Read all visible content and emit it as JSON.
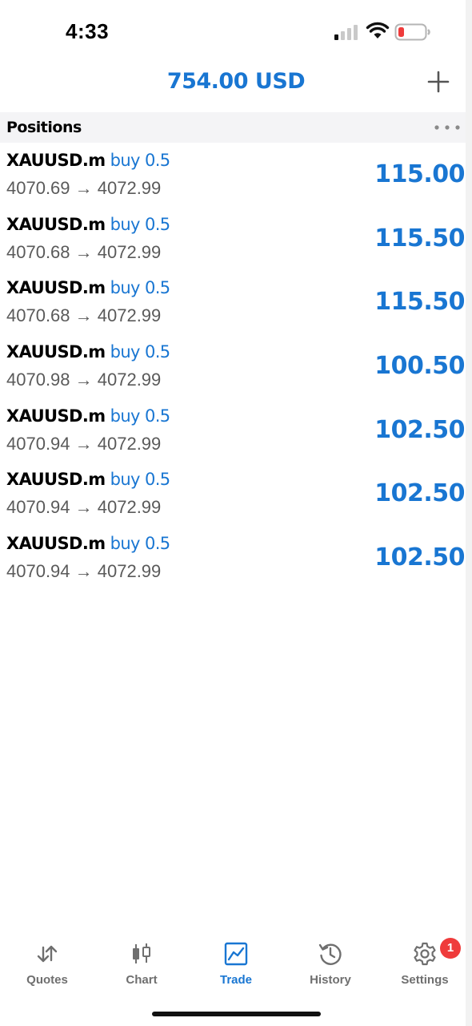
{
  "status_bar": {
    "time": "4:33",
    "signal_icon": "cellular-signal-icon",
    "wifi_icon": "wifi-icon",
    "battery_icon": "battery-low-icon",
    "battery_color": "#ef3b3b"
  },
  "header": {
    "balance": "754.00 USD",
    "add_icon": "plus-icon"
  },
  "section": {
    "title": "Positions",
    "more_icon": "more-dots-icon"
  },
  "positions": [
    {
      "symbol": "XAUUSD.m",
      "side": "buy 0.5",
      "prices": "4070.69 → 4072.99",
      "profit": "115.00"
    },
    {
      "symbol": "XAUUSD.m",
      "side": "buy 0.5",
      "prices": "4070.68 → 4072.99",
      "profit": "115.50"
    },
    {
      "symbol": "XAUUSD.m",
      "side": "buy 0.5",
      "prices": "4070.68 → 4072.99",
      "profit": "115.50"
    },
    {
      "symbol": "XAUUSD.m",
      "side": "buy 0.5",
      "prices": "4070.98 → 4072.99",
      "profit": "100.50"
    },
    {
      "symbol": "XAUUSD.m",
      "side": "buy 0.5",
      "prices": "4070.94 → 4072.99",
      "profit": "102.50"
    },
    {
      "symbol": "XAUUSD.m",
      "side": "buy 0.5",
      "prices": "4070.94 → 4072.99",
      "profit": "102.50"
    },
    {
      "symbol": "XAUUSD.m",
      "side": "buy 0.5",
      "prices": "4070.94 → 4072.99",
      "profit": "102.50"
    }
  ],
  "tabs": [
    {
      "label": "Quotes",
      "icon": "quotes-arrows-icon"
    },
    {
      "label": "Chart",
      "icon": "candlestick-chart-icon"
    },
    {
      "label": "Trade",
      "icon": "trade-chart-icon",
      "active": true
    },
    {
      "label": "History",
      "icon": "history-clock-icon"
    },
    {
      "label": "Settings",
      "icon": "gear-icon",
      "badge": "1"
    }
  ],
  "colors": {
    "accent": "#1976d2",
    "inactive_tab": "#6f6f6f",
    "badge": "#ef3b3b",
    "section_background": "#f4f4f6"
  }
}
